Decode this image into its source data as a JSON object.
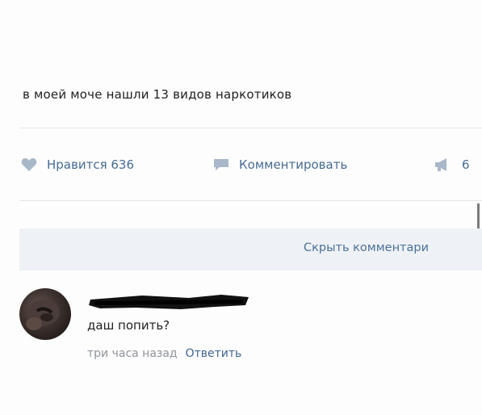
{
  "post": {
    "text": "в моей моче нашли 13 видов наркотиков"
  },
  "actions": {
    "like_label": "Нравится 636",
    "comment_label": "Комментировать",
    "share_count": "6"
  },
  "comments_bar": {
    "hide_label": "Скрыть комментари"
  },
  "comment": {
    "text": "даш попить?",
    "time": "три часа назад",
    "reply_label": "Ответить"
  },
  "colors": {
    "link": "#466b94",
    "icon": "#a8b7c9",
    "bar_background": "#eef1f5",
    "muted_text": "#8f9399"
  },
  "icons": {
    "like": "heart-icon",
    "comment": "speech-bubble-icon",
    "share": "megaphone-icon"
  }
}
